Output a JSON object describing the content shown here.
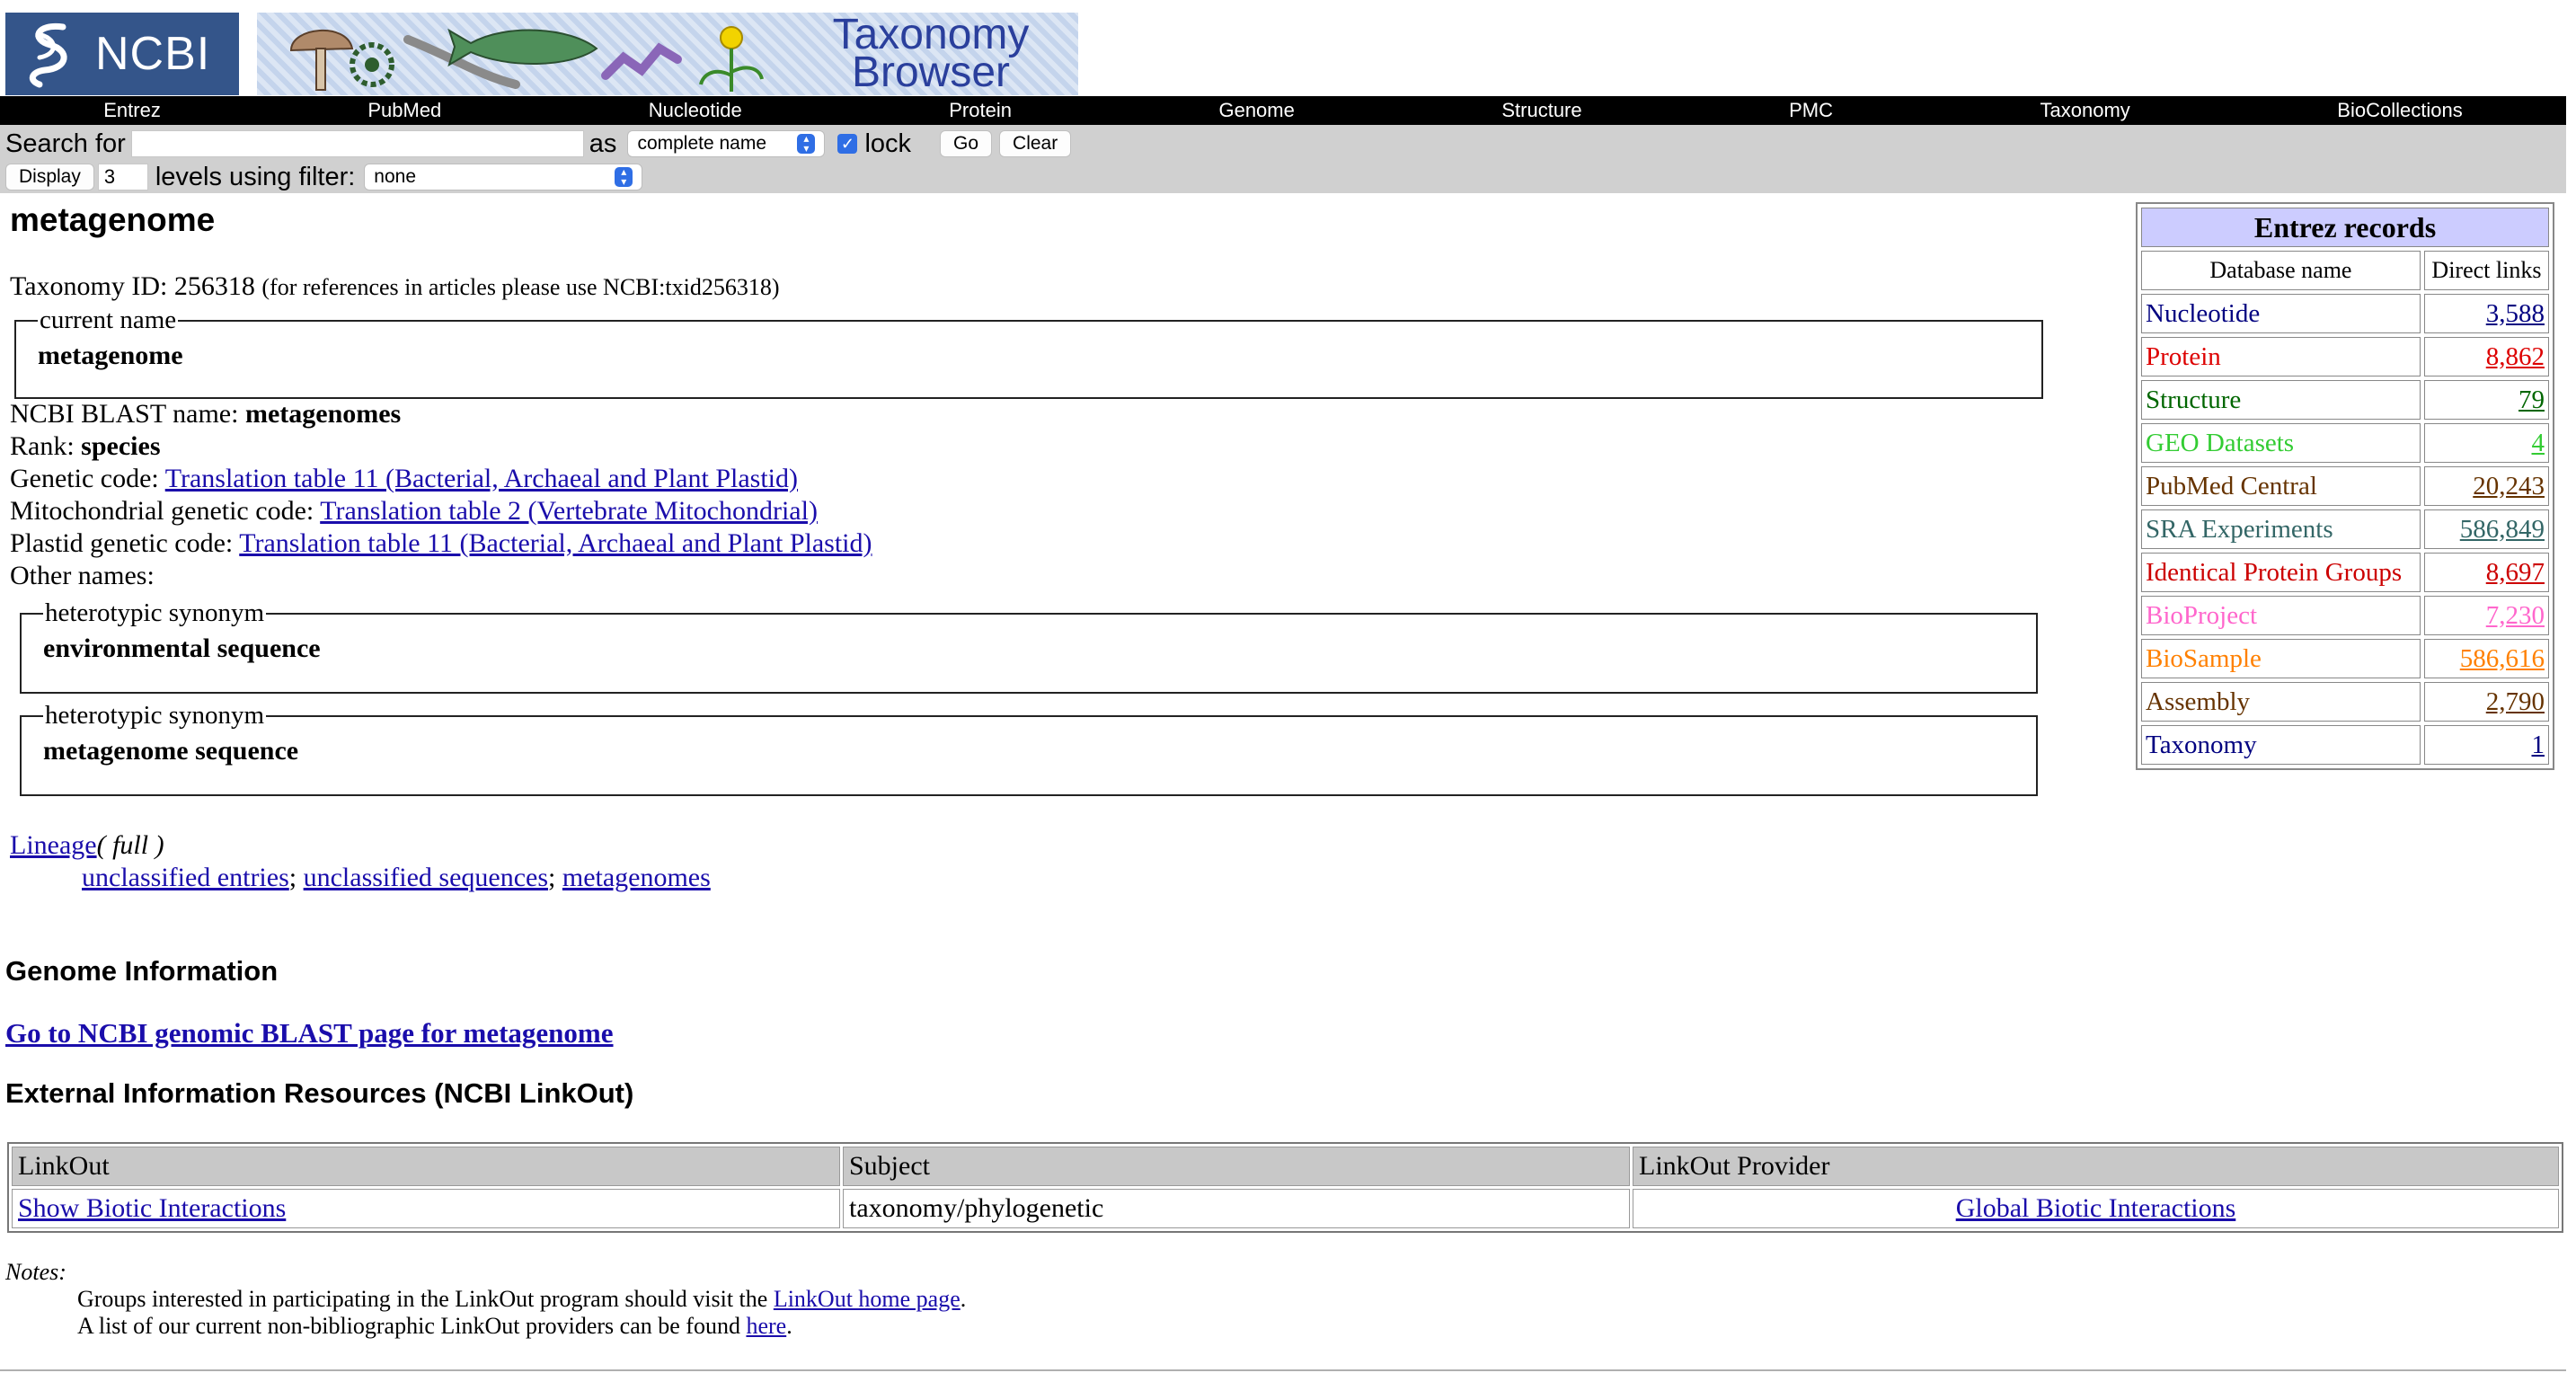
{
  "header": {
    "logo_text": "NCBI",
    "banner_title_line1": "Taxonomy",
    "banner_title_line2": "Browser"
  },
  "nav": [
    "Entrez",
    "PubMed",
    "Nucleotide",
    "Protein",
    "Genome",
    "Structure",
    "PMC",
    "Taxonomy",
    "BioCollections"
  ],
  "search": {
    "label": "Search for",
    "value": "",
    "as_label": "as",
    "as_selected": "complete name",
    "lock_label": "lock",
    "lock_checked": true,
    "go_label": "Go",
    "clear_label": "Clear",
    "display_label": "Display",
    "levels_value": "3",
    "levels_label": "levels using filter:",
    "filter_selected": "none"
  },
  "page": {
    "title": "metagenome",
    "taxid_label": "Taxonomy ID: 256318",
    "taxid_note": "(for references in articles please use NCBI:txid256318)",
    "current_name_legend": "current name",
    "current_name": "metagenome",
    "blast_name_label": "NCBI BLAST name:",
    "blast_name": "metagenomes",
    "rank_label": "Rank:",
    "rank": "species",
    "genetic_code_label": "Genetic code:",
    "genetic_code": "Translation table 11 (Bacterial, Archaeal and Plant Plastid)",
    "mito_code_label": "Mitochondrial genetic code:",
    "mito_code": "Translation table 2 (Vertebrate Mitochondrial)",
    "plastid_code_label": "Plastid genetic code:",
    "plastid_code": "Translation table 11 (Bacterial, Archaeal and Plant Plastid)",
    "other_names_label": "Other names:",
    "synonyms": [
      {
        "legend": "heterotypic synonym",
        "name": "environmental sequence"
      },
      {
        "legend": "heterotypic synonym",
        "name": "metagenome sequence"
      }
    ],
    "lineage_label": "Lineage",
    "lineage_full": "( full )",
    "lineage": [
      "unclassified entries",
      "unclassified sequences",
      "metagenomes"
    ],
    "genome_heading": "Genome Information",
    "blast_link": "Go to NCBI genomic BLAST page for metagenome",
    "external_heading": "External Information Resources (NCBI LinkOut)"
  },
  "linkout": {
    "headers": [
      "LinkOut",
      "Subject",
      "LinkOut Provider"
    ],
    "rows": [
      {
        "link": "Show Biotic Interactions",
        "subject": "taxonomy/phylogenetic",
        "provider": "Global Biotic Interactions"
      }
    ]
  },
  "notes": {
    "label": "Notes:",
    "line1_pre": "Groups interested in participating in the LinkOut program should visit the",
    "line1_link": "LinkOut home page",
    "line1_post": ".",
    "line2_pre": "A list of our current non-bibliographic LinkOut providers can be found",
    "line2_link": "here",
    "line2_post": "."
  },
  "entrez": {
    "title": "Entrez records",
    "col_db": "Database name",
    "col_links": "Direct links",
    "rows": [
      {
        "name": "Nucleotide",
        "count": "3,588",
        "color": "#000080"
      },
      {
        "name": "Protein",
        "count": "8,862",
        "color": "#dd0000"
      },
      {
        "name": "Structure",
        "count": "79",
        "color": "#006600"
      },
      {
        "name": "GEO Datasets",
        "count": "4",
        "color": "#33cc33"
      },
      {
        "name": "PubMed Central",
        "count": "20,243",
        "color": "#663300"
      },
      {
        "name": "SRA Experiments",
        "count": "586,849",
        "color": "#336666"
      },
      {
        "name": "Identical Protein Groups",
        "count": "8,697",
        "color": "#cc0000"
      },
      {
        "name": "BioProject",
        "count": "7,230",
        "color": "#ff66cc"
      },
      {
        "name": "BioSample",
        "count": "586,616",
        "color": "#ff8000"
      },
      {
        "name": "Assembly",
        "count": "2,790",
        "color": "#663300"
      },
      {
        "name": "Taxonomy",
        "count": "1",
        "color": "#000080"
      }
    ]
  }
}
